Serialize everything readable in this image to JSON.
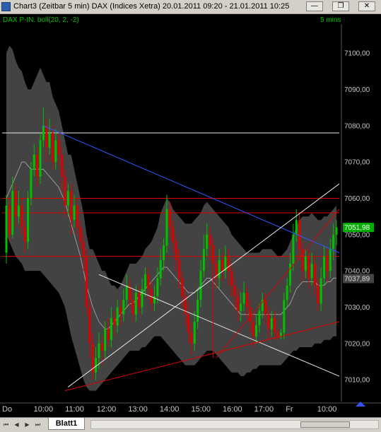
{
  "window": {
    "title": "Chart3 (Zeitbar 5 min)  DAX (Indices Xetra) 20.01.2011 09:20 - 21.01.2011 10:25",
    "minimize_glyph": "—",
    "restore_glyph": "❐",
    "close_glyph": "✕"
  },
  "chart": {
    "indicator_label": "DAX P-IN. boll(20, 2, -2)",
    "timeframe_label": "5 mins",
    "corner_icon": "tools-icon",
    "colors": {
      "background": "#000000",
      "up": "#00c000",
      "down": "#e00000",
      "band_fill": "#4a4a4a",
      "axis_text": "#c8c8c8",
      "blue_trend": "#2f56ff",
      "white_line": "#e8e8e8",
      "red_line": "#e00000",
      "price_box": "#00b000"
    }
  },
  "chart_data": {
    "type": "candlestick",
    "y_ticks": [
      "7100,00",
      "7090,00",
      "7080,00",
      "7070,00",
      "7060,00",
      "7050,00",
      "7040,00",
      "7030,00",
      "7020,00",
      "7010,00"
    ],
    "x_ticks": [
      "Do",
      "10:00",
      "11:00",
      "12:00",
      "13:00",
      "14:00",
      "15:00",
      "16:00",
      "17:00",
      "Fr",
      "10:00"
    ],
    "ylim": [
      7004,
      7108
    ],
    "last_price_label": "7051,98",
    "secondary_price_label": "7037,89",
    "horizontal_levels": [
      7078,
      7060,
      7056,
      7044
    ],
    "candles_count": 108,
    "candles": [
      [
        7045,
        7058,
        7042,
        7061
      ],
      [
        7058,
        7050,
        7048,
        7060
      ],
      [
        7050,
        7062,
        7049,
        7066
      ],
      [
        7062,
        7055,
        7052,
        7064
      ],
      [
        7055,
        7058,
        7053,
        7062
      ],
      [
        7058,
        7052,
        7050,
        7060
      ],
      [
        7052,
        7048,
        7045,
        7054
      ],
      [
        7048,
        7060,
        7046,
        7062
      ],
      [
        7060,
        7068,
        7058,
        7070
      ],
      [
        7068,
        7072,
        7066,
        7075
      ],
      [
        7072,
        7066,
        7063,
        7074
      ],
      [
        7066,
        7076,
        7064,
        7078
      ],
      [
        7076,
        7080,
        7074,
        7085
      ],
      [
        7080,
        7074,
        7070,
        7082
      ],
      [
        7074,
        7078,
        7072,
        7082
      ],
      [
        7078,
        7070,
        7068,
        7080
      ],
      [
        7070,
        7076,
        7068,
        7079
      ],
      [
        7076,
        7072,
        7069,
        7078
      ],
      [
        7072,
        7066,
        7062,
        7074
      ],
      [
        7066,
        7058,
        7055,
        7068
      ],
      [
        7058,
        7062,
        7055,
        7064
      ],
      [
        7062,
        7054,
        7050,
        7064
      ],
      [
        7054,
        7058,
        7052,
        7061
      ],
      [
        7058,
        7052,
        7050,
        7060
      ],
      [
        7052,
        7048,
        7046,
        7054
      ],
      [
        7048,
        7044,
        7040,
        7050
      ],
      [
        7044,
        7030,
        7028,
        7046
      ],
      [
        7030,
        7020,
        7016,
        7032
      ],
      [
        7020,
        7012,
        7010,
        7023
      ],
      [
        7012,
        7016,
        7010,
        7019
      ],
      [
        7016,
        7020,
        7013,
        7023
      ],
      [
        7020,
        7018,
        7014,
        7022
      ],
      [
        7018,
        7024,
        7016,
        7026
      ],
      [
        7024,
        7021,
        7019,
        7027
      ],
      [
        7021,
        7027,
        7019,
        7030
      ],
      [
        7027,
        7025,
        7022,
        7029
      ],
      [
        7025,
        7030,
        7023,
        7032
      ],
      [
        7030,
        7028,
        7025,
        7032
      ],
      [
        7028,
        7032,
        7026,
        7035
      ],
      [
        7032,
        7036,
        7030,
        7039
      ],
      [
        7036,
        7032,
        7030,
        7038
      ],
      [
        7032,
        7028,
        7026,
        7034
      ],
      [
        7028,
        7034,
        7026,
        7036
      ],
      [
        7034,
        7030,
        7028,
        7036
      ],
      [
        7030,
        7035,
        7028,
        7038
      ],
      [
        7035,
        7039,
        7033,
        7041
      ],
      [
        7039,
        7035,
        7032,
        7041
      ],
      [
        7035,
        7031,
        7029,
        7037
      ],
      [
        7031,
        7033,
        7029,
        7036
      ],
      [
        7033,
        7038,
        7031,
        7041
      ],
      [
        7038,
        7043,
        7036,
        7046
      ],
      [
        7043,
        7047,
        7040,
        7049
      ],
      [
        7047,
        7057,
        7045,
        7061
      ],
      [
        7057,
        7052,
        7049,
        7059
      ],
      [
        7052,
        7048,
        7045,
        7054
      ],
      [
        7048,
        7043,
        7040,
        7050
      ],
      [
        7043,
        7038,
        7035,
        7046
      ],
      [
        7038,
        7033,
        7030,
        7040
      ],
      [
        7033,
        7028,
        7025,
        7035
      ],
      [
        7028,
        7023,
        7020,
        7031
      ],
      [
        7023,
        7020,
        7017,
        7026
      ],
      [
        7020,
        7026,
        7018,
        7029
      ],
      [
        7026,
        7032,
        7024,
        7035
      ],
      [
        7032,
        7040,
        7030,
        7043
      ],
      [
        7040,
        7046,
        7038,
        7050
      ],
      [
        7046,
        7050,
        7044,
        7053
      ],
      [
        7050,
        7047,
        7043,
        7052
      ],
      [
        7047,
        7042,
        7039,
        7049
      ],
      [
        7042,
        7038,
        7035,
        7044
      ],
      [
        7038,
        7043,
        7035,
        7046
      ],
      [
        7043,
        7040,
        7037,
        7045
      ],
      [
        7040,
        7044,
        7038,
        7047
      ],
      [
        7044,
        7040,
        7036,
        7046
      ],
      [
        7040,
        7036,
        7033,
        7042
      ],
      [
        7036,
        7033,
        7030,
        7038
      ],
      [
        7033,
        7029,
        7026,
        7035
      ],
      [
        7029,
        7031,
        7026,
        7034
      ],
      [
        7031,
        7034,
        7029,
        7037
      ],
      [
        7034,
        7030,
        7027,
        7036
      ],
      [
        7030,
        7026,
        7023,
        7032
      ],
      [
        7026,
        7022,
        7019,
        7028
      ],
      [
        7022,
        7025,
        7020,
        7028
      ],
      [
        7025,
        7029,
        7023,
        7031
      ],
      [
        7029,
        7032,
        7027,
        7034
      ],
      [
        7032,
        7028,
        7025,
        7034
      ],
      [
        7028,
        7024,
        7021,
        7030
      ],
      [
        7024,
        7027,
        7022,
        7029
      ],
      [
        7027,
        7023,
        7021,
        7029
      ],
      [
        7023,
        7022,
        7021,
        7024
      ],
      [
        7022,
        7023,
        7021,
        7024
      ],
      [
        7023,
        7032,
        7021,
        7034
      ],
      [
        7032,
        7036,
        7030,
        7038
      ],
      [
        7036,
        7042,
        7034,
        7045
      ],
      [
        7042,
        7050,
        7040,
        7053
      ],
      [
        7050,
        7054,
        7048,
        7057
      ],
      [
        7054,
        7046,
        7043,
        7056
      ],
      [
        7046,
        7040,
        7037,
        7048
      ],
      [
        7040,
        7044,
        7038,
        7046
      ],
      [
        7044,
        7038,
        7035,
        7046
      ],
      [
        7038,
        7042,
        7036,
        7045
      ],
      [
        7042,
        7036,
        7033,
        7044
      ],
      [
        7036,
        7031,
        7029,
        7038
      ],
      [
        7031,
        7038,
        7029,
        7041
      ],
      [
        7038,
        7044,
        7036,
        7047
      ],
      [
        7044,
        7040,
        7037,
        7046
      ],
      [
        7040,
        7046,
        7038,
        7049
      ],
      [
        7046,
        7050,
        7043,
        7053
      ],
      [
        7050,
        7052,
        7047,
        7054
      ]
    ],
    "bollinger_upper": [
      7100,
      7102,
      7101,
      7098,
      7096,
      7095,
      7092,
      7090,
      7090,
      7092,
      7094,
      7096,
      7094,
      7092,
      7092,
      7088,
      7086,
      7084,
      7080,
      7076,
      7072,
      7072,
      7068,
      7064,
      7060,
      7056,
      7050,
      7046,
      7046,
      7044,
      7042,
      7040,
      7040,
      7038,
      7036,
      7036,
      7035,
      7036,
      7038,
      7040,
      7042,
      7042,
      7042,
      7043,
      7044,
      7046,
      7047,
      7048,
      7050,
      7052,
      7056,
      7058,
      7060,
      7059,
      7057,
      7056,
      7055,
      7054,
      7053,
      7053,
      7053,
      7054,
      7055,
      7056,
      7058,
      7059,
      7058,
      7057,
      7056,
      7055,
      7054,
      7053,
      7052,
      7050,
      7049,
      7048,
      7047,
      7046,
      7045,
      7045,
      7045,
      7045,
      7045,
      7046,
      7046,
      7046,
      7046,
      7045,
      7044,
      7044,
      7045,
      7046,
      7048,
      7050,
      7052,
      7054,
      7055,
      7055,
      7055,
      7056,
      7055,
      7054,
      7054,
      7055,
      7055,
      7056,
      7057,
      7058
    ],
    "bollinger_mid": [
      7060,
      7062,
      7064,
      7066,
      7068,
      7070,
      7070,
      7069,
      7068,
      7068,
      7068,
      7068,
      7068,
      7067,
      7066,
      7065,
      7064,
      7063,
      7061,
      7059,
      7056,
      7053,
      7050,
      7047,
      7044,
      7040,
      7036,
      7033,
      7030,
      7028,
      7026,
      7025,
      7024,
      7024,
      7025,
      7026,
      7027,
      7028,
      7029,
      7030,
      7031,
      7031,
      7032,
      7033,
      7034,
      7035,
      7036,
      7037,
      7038,
      7039,
      7040,
      7041,
      7041,
      7040,
      7039,
      7038,
      7037,
      7036,
      7035,
      7034,
      7034,
      7034,
      7035,
      7036,
      7037,
      7038,
      7038,
      7037,
      7036,
      7035,
      7034,
      7033,
      7032,
      7031,
      7030,
      7029,
      7028,
      7028,
      7028,
      7028,
      7028,
      7028,
      7028,
      7028,
      7028,
      7028,
      7028,
      7028,
      7028,
      7028,
      7029,
      7030,
      7031,
      7033,
      7035,
      7036,
      7037,
      7037,
      7037,
      7037,
      7037,
      7036,
      7036,
      7036,
      7037,
      7037,
      7038,
      7038
    ],
    "bollinger_lower": [
      7050,
      7048,
      7046,
      7044,
      7043,
      7042,
      7040,
      7040,
      7040,
      7040,
      7040,
      7040,
      7039,
      7038,
      7037,
      7036,
      7035,
      7034,
      7032,
      7030,
      7026,
      7022,
      7019,
      7016,
      7013,
      7010,
      7008,
      7007,
      7007,
      7007,
      7008,
      7009,
      7010,
      7011,
      7012,
      7013,
      7014,
      7015,
      7016,
      7017,
      7018,
      7018,
      7018,
      7018,
      7019,
      7019,
      7020,
      7021,
      7022,
      7022,
      7022,
      7021,
      7020,
      7019,
      7018,
      7017,
      7016,
      7015,
      7014,
      7014,
      7014,
      7014,
      7015,
      7016,
      7017,
      7018,
      7018,
      7018,
      7017,
      7016,
      7015,
      7014,
      7013,
      7012,
      7012,
      7012,
      7011,
      7011,
      7012,
      7012,
      7013,
      7013,
      7014,
      7014,
      7014,
      7014,
      7014,
      7014,
      7014,
      7014,
      7015,
      7016,
      7017,
      7018,
      7018,
      7019,
      7019,
      7019,
      7019,
      7019,
      7020,
      7020,
      7020,
      7021,
      7021,
      7021,
      7022,
      7022
    ]
  },
  "statusbar": {
    "nav_first": "⏮",
    "nav_prev": "◀",
    "nav_next": "▶",
    "nav_last": "⏭",
    "sheet_tab": "Blatt1"
  }
}
